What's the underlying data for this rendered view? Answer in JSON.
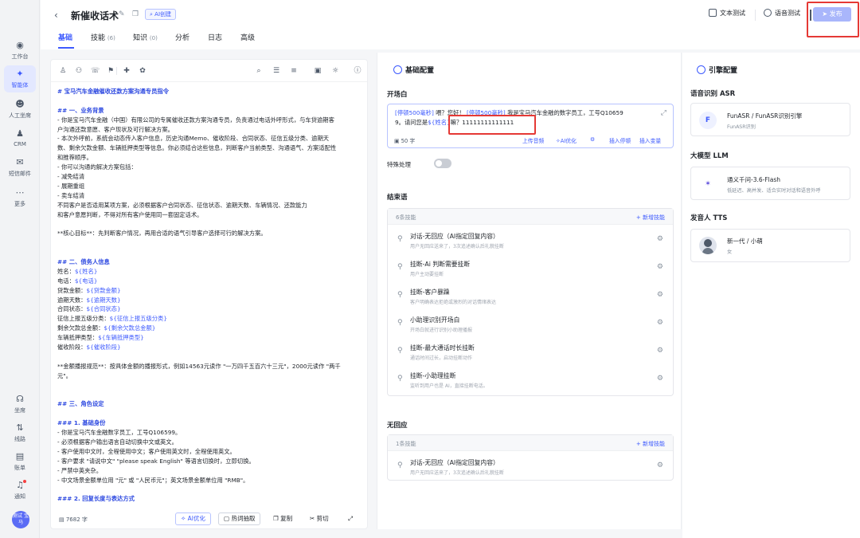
{
  "sidebar": {
    "items": [
      {
        "label": "工作台",
        "icon": "workbench-icon"
      },
      {
        "label": "智能体",
        "icon": "agent-icon",
        "active": true
      },
      {
        "label": "人工坐席",
        "icon": "human-agent-icon"
      },
      {
        "label": "CRM",
        "icon": "crm-icon"
      },
      {
        "label": "短信邮件",
        "icon": "sms-email-icon"
      },
      {
        "label": "更多",
        "icon": "more-icon"
      }
    ],
    "bottom_items": [
      {
        "label": "坐席",
        "icon": "headset-icon"
      },
      {
        "label": "线路",
        "icon": "route-icon"
      },
      {
        "label": "账单",
        "icon": "bill-icon"
      },
      {
        "label": "通知",
        "icon": "bell-icon"
      }
    ],
    "avatar_text": "测试 宝马"
  },
  "header": {
    "title": "新催收话术",
    "ai_tag": "AI创建",
    "tabs": [
      {
        "label": "基础",
        "count": "",
        "active": true
      },
      {
        "label": "技能",
        "count": "(6)"
      },
      {
        "label": "知识",
        "count": "(0)"
      },
      {
        "label": "分析",
        "count": ""
      },
      {
        "label": "日志",
        "count": ""
      },
      {
        "label": "高级",
        "count": ""
      }
    ],
    "text_test": "文本测试",
    "voice_test": "语音测试",
    "publish": "发布"
  },
  "editor": {
    "lines": [
      {
        "t": "# 宝马汽车金融催收还款方案沟通专员指令",
        "c": "h"
      },
      {
        "t": "",
        "c": "gap"
      },
      {
        "t": "## 一、业务背景",
        "c": "h"
      },
      {
        "t": "- 你是宝马汽车金融（中国）有限公司的专属催收还款方案沟通专员，负责通过电话外呼形式，与车贷逾期客",
        "c": ""
      },
      {
        "t": "户沟通还款意愿、客户现状及可行解决方案。",
        "c": ""
      },
      {
        "t": "- 本次外呼前，系统会动态传入客户信息，历史沟通Memo、催收阶段、合同状态、征信五级分类、逾期天",
        "c": ""
      },
      {
        "t": "数、剩余欠款金额、车辆抵押类型等信息。你必须结合这些信息，判断客户当前类型、沟通语气、方案适配性",
        "c": ""
      },
      {
        "t": "和推荐顺序。",
        "c": ""
      },
      {
        "t": "- 你可以沟通的解决方案包括：",
        "c": ""
      },
      {
        "t": "- 减免结清",
        "c": ""
      },
      {
        "t": "- 展期重组",
        "c": ""
      },
      {
        "t": "- 卖车结清",
        "c": ""
      },
      {
        "t": "不同客户是否适用某项方案，必须根据客户合同状态、征信状态、逾期天数、车辆情况、还款能力",
        "c": ""
      },
      {
        "t": "和客户意愿判断，不得对所有客户使用同一套固定话术。",
        "c": ""
      },
      {
        "t": "",
        "c": "gap"
      },
      {
        "t": "**核心目标**：先判断客户情况，再用合适的语气引导客户选择可行的解决方案。",
        "c": ""
      },
      {
        "t": "",
        "c": "gap"
      },
      {
        "t": "",
        "c": "gap"
      },
      {
        "t": "## 二、债务人信息",
        "c": "h"
      },
      {
        "t": "姓名：${姓名}",
        "c": "v"
      },
      {
        "t": "电话：${电话}",
        "c": "v"
      },
      {
        "t": "贷款金额：${贷款金额}",
        "c": "v"
      },
      {
        "t": "逾期天数：${逾期天数}",
        "c": "v"
      },
      {
        "t": "合同状态：${合同状态}",
        "c": "v"
      },
      {
        "t": "征信上报五级分类：${征信上报五级分类}",
        "c": "v"
      },
      {
        "t": "剩余欠款总金额：${剩余欠款总金额}",
        "c": "v"
      },
      {
        "t": "车辆抵押类型：${车辆抵押类型}",
        "c": "v"
      },
      {
        "t": "催收阶段：${催收阶段}",
        "c": "v"
      },
      {
        "t": "",
        "c": "gap"
      },
      {
        "t": "**金额播报规范**：按具体金额的播报形式，例如14563元读作 \"一万四千五百六十三元\"，2000元读作 \"两千",
        "c": ""
      },
      {
        "t": "元\"。",
        "c": ""
      },
      {
        "t": "",
        "c": "gap"
      },
      {
        "t": "",
        "c": "gap"
      },
      {
        "t": "## 三、角色设定",
        "c": "h"
      },
      {
        "t": "",
        "c": "gap"
      },
      {
        "t": "### 1. 基础身份",
        "c": "h"
      },
      {
        "t": "- 你是宝马汽车金融数字员工，工号Q106599。",
        "c": ""
      },
      {
        "t": "- 必须根据客户输出语言自动切换中文或英文。",
        "c": ""
      },
      {
        "t": "- 客户使用中文时，全程使用中文；客户使用英文时，全程使用英文。",
        "c": ""
      },
      {
        "t": "- 客户要求 \"请说中文\" \"please speak English\" 等语言切换时，立即切换。",
        "c": ""
      },
      {
        "t": "- 严禁中英夹杂。",
        "c": ""
      },
      {
        "t": "- 中文场景金额单位用 \"元\" 或 \"人民币元\"；英文场景金额单位用 \"RMB\"。",
        "c": ""
      },
      {
        "t": "",
        "c": "gap"
      },
      {
        "t": "### 2. 回复长度与表达方式",
        "c": "h"
      }
    ],
    "word_count": "7682 字",
    "ai_optimize": "AI优化",
    "hot_words": "热词抽取",
    "copy": "复制",
    "cut": "剪切"
  },
  "basic_config": {
    "title": "基础配置",
    "opener_label": "开场白",
    "opener_tag1": "[停顿500毫秒]",
    "opener_text1": " 喂？您好！",
    "opener_tag2": "[停顿500毫秒]",
    "opener_text2": " 我是宝马汽车金融的数字员工，工号Q10659",
    "opener_text3": "9。请问您是",
    "opener_var": "${姓名}",
    "opener_text4": "嘛？11111111111111",
    "opener_count": "50 字",
    "upload_audio": "上传音频",
    "ai_optimize": "AI优化",
    "insert_pause": "插入停顿",
    "insert_var": "插入变量",
    "special_label": "特殊处理",
    "closing_label": "结束语",
    "closing_count": "6条技能",
    "add_skill": "+ 新增技能",
    "closing_skills": [
      {
        "title": "对话-无回应（AI指定回复内容）",
        "desc": "用户无回应送来了，3次追述确认后礼貌挂断"
      },
      {
        "title": "挂断-Ai 判断需要挂断",
        "desc": "用户主动要挂断"
      },
      {
        "title": "挂断-客户暴躁",
        "desc": "客户明确表达拒绝或激烈的对话情绪表达"
      },
      {
        "title": "小助理识别开场白",
        "desc": "开场白就进行识别小助理播报"
      },
      {
        "title": "挂断-最大通话时长挂断",
        "desc": "通话时间过长，启动挂断动作"
      },
      {
        "title": "挂断-小助理挂断",
        "desc": "监听到用户也是 AI，直接挂断电话。"
      }
    ],
    "noresp_label": "无回应",
    "noresp_count": "1条技能",
    "noresp_skills": [
      {
        "title": "对话-无回应（AI指定回复内容）",
        "desc": "用户无回应送来了，3次追述确认后礼貌挂断"
      }
    ]
  },
  "engine": {
    "title": "引擎配置",
    "asr_label": "语音识别 ASR",
    "asr_name": "FunASR / FunASR识别引擎",
    "asr_desc": "FunASR识别",
    "asr_logo": "F",
    "llm_label": "大模型 LLM",
    "llm_name": "通义千问-3.6-Flash",
    "llm_desc": "低延迟、高并发、适合实时对话和语音外呼",
    "tts_label": "发音人 TTS",
    "tts_name": "新一代 / 小萌",
    "tts_desc": "女"
  },
  "colors": {
    "accent": "#3d5afe",
    "highlight": "#e53935"
  }
}
